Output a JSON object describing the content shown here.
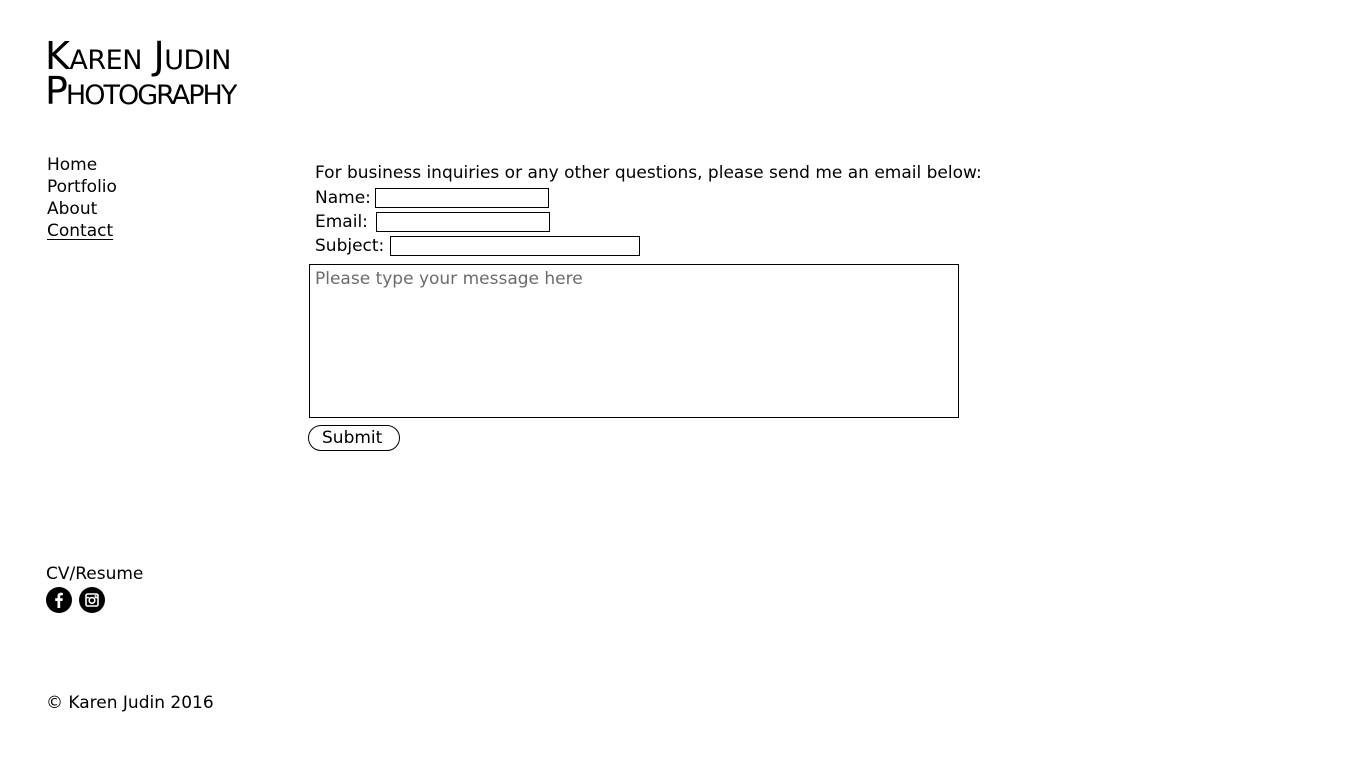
{
  "logo": {
    "line1": "Karen Judin",
    "line2": "Photography"
  },
  "nav": {
    "items": [
      {
        "label": "Home",
        "active": false
      },
      {
        "label": "Portfolio",
        "active": false
      },
      {
        "label": "About",
        "active": false
      },
      {
        "label": "Contact",
        "active": true
      }
    ]
  },
  "form": {
    "intro": "For business inquiries or any other questions, please send me an email below:",
    "name_label": "Name:",
    "name_value": "",
    "email_label": "Email:",
    "email_value": "",
    "subject_label": "Subject:",
    "subject_value": "",
    "message_placeholder": "Please type your message here",
    "submit_label": "Submit"
  },
  "links": {
    "cv": "CV/Resume",
    "social": [
      {
        "icon": "facebook-icon"
      },
      {
        "icon": "instagram-icon"
      }
    ]
  },
  "footer": {
    "copyright": "© Karen Judin 2016"
  }
}
